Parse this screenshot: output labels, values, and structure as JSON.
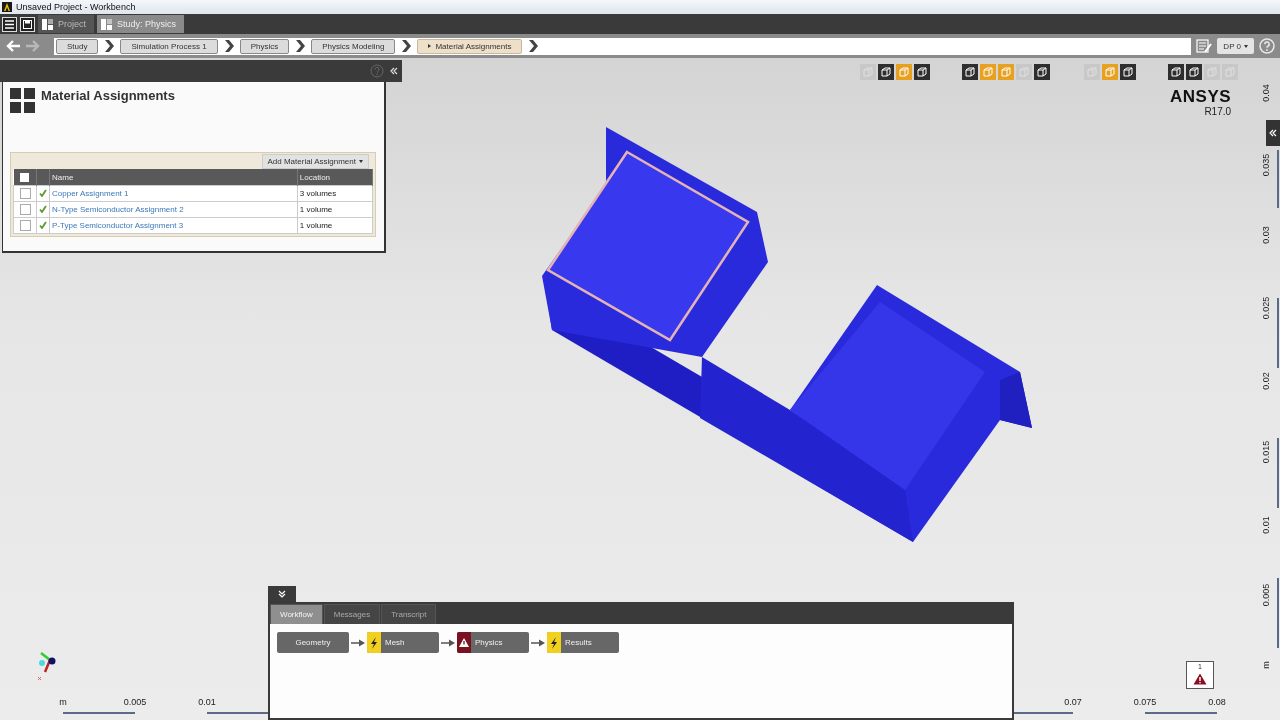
{
  "window": {
    "title": "Unsaved Project - Workbench"
  },
  "tabs": [
    {
      "label": "Project",
      "selected": false
    },
    {
      "label": "Study: Physics",
      "selected": true
    }
  ],
  "breadcrumbs": [
    {
      "label": "Study",
      "selected": false
    },
    {
      "label": "Simulation Process 1",
      "selected": false
    },
    {
      "label": "Physics",
      "selected": false
    },
    {
      "label": "Physics Modeling",
      "selected": false
    },
    {
      "label": "Material Assignments",
      "selected": true
    }
  ],
  "dp_menu": "DP 0",
  "panel": {
    "title": "Material Assignments",
    "add_button": "Add Material Assignment",
    "columns": [
      "Name",
      "Location"
    ],
    "all_checked": false,
    "rows": [
      {
        "name": "Copper Assignment 1",
        "location": "3 volumes",
        "checked": false,
        "valid": true
      },
      {
        "name": "N-Type Semiconductor Assignment 2",
        "location": "1 volume",
        "checked": false,
        "valid": true
      },
      {
        "name": "P-Type Semiconductor Assignment 3",
        "location": "1 volume",
        "checked": false,
        "valid": true
      }
    ]
  },
  "toolbar_groups": [
    [
      {
        "active": false,
        "disabled": true
      },
      {
        "active": false,
        "disabled": false
      },
      {
        "active": true,
        "disabled": false
      },
      {
        "active": false,
        "disabled": false
      }
    ],
    [
      {
        "active": false,
        "disabled": false
      },
      {
        "active": true,
        "disabled": false
      },
      {
        "active": true,
        "disabled": false
      },
      {
        "active": false,
        "disabled": true
      },
      {
        "active": false,
        "disabled": false
      }
    ],
    [
      {
        "active": false,
        "disabled": true
      },
      {
        "active": true,
        "disabled": false
      },
      {
        "active": false,
        "disabled": false
      }
    ],
    [
      {
        "active": false,
        "disabled": false
      },
      {
        "active": false,
        "disabled": false
      },
      {
        "active": false,
        "disabled": true
      },
      {
        "active": false,
        "disabled": true
      }
    ]
  ],
  "logo": {
    "brand": "ANSYS",
    "version": "R17.0"
  },
  "ruler_vertical": [
    "0.04",
    "0.035",
    "0.03",
    "0.025",
    "0.02",
    "0.015",
    "0.01",
    "0.005",
    "m"
  ],
  "ruler_horizontal": [
    "m",
    "0.005",
    "0.01",
    "0.07",
    "0.075",
    "0.08"
  ],
  "workflow": {
    "tabs": [
      {
        "label": "Workflow",
        "selected": true
      },
      {
        "label": "Messages",
        "selected": false
      },
      {
        "label": "Transcript",
        "selected": false
      }
    ],
    "steps": [
      {
        "label": "Geometry",
        "needs_update": false,
        "error": false
      },
      {
        "label": "Mesh",
        "needs_update": true,
        "error": false
      },
      {
        "label": "Physics",
        "needs_update": false,
        "error": true
      },
      {
        "label": "Results",
        "needs_update": true,
        "error": false
      }
    ]
  },
  "warning_badge": {
    "count": "1"
  }
}
